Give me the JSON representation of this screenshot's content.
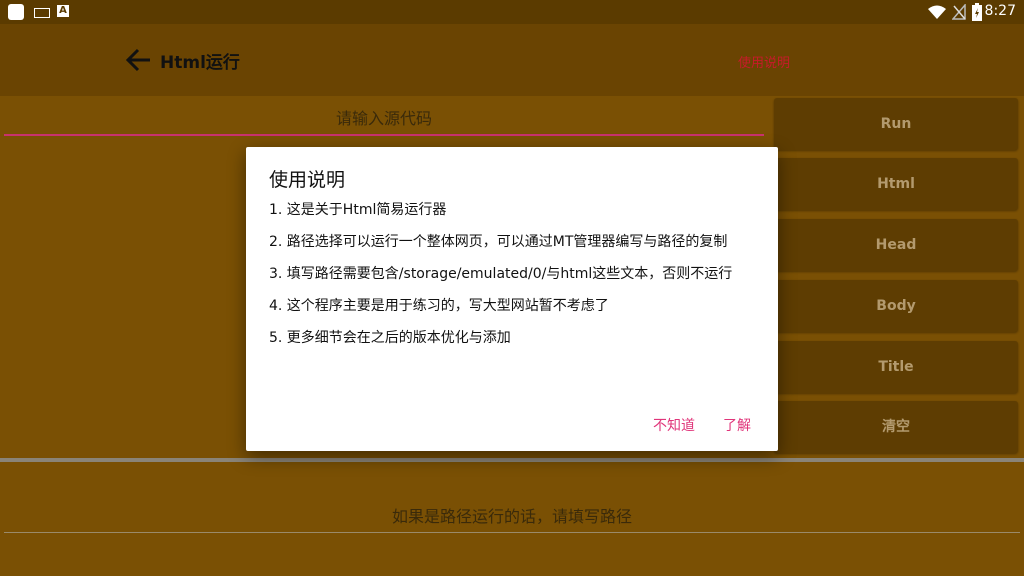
{
  "status_bar": {
    "time": "8:27"
  },
  "app_bar": {
    "title": "Html运行",
    "help_link": "使用说明"
  },
  "editor": {
    "placeholder": "请输入源代码"
  },
  "side_buttons": [
    "Run",
    "Html",
    "Head",
    "Body",
    "Title",
    "清空"
  ],
  "path_input": {
    "placeholder": "如果是路径运行的话，请填写路径"
  },
  "dialog": {
    "title": "使用说明",
    "lines": [
      "1. 这是关于Html简易运行器",
      " 2. 路径选择可以运行一个整体网页，可以通过MT管理器编写与路径的复制",
      "3. 填写路径需要包含/storage/emulated/0/与html这些文本，否则不运行",
      "4. 这个程序主要是用于练习的，写大型网站暂不考虑了",
      "5. 更多细节会在之后的版本优化与添加"
    ],
    "negative_button": "不知道",
    "positive_button": "了解"
  },
  "colors": {
    "background": "#7a5004",
    "app_bar": "#6a4402",
    "side_button": "#5e3d02",
    "accent": "#e0357a",
    "help_link": "#c81a2a"
  }
}
